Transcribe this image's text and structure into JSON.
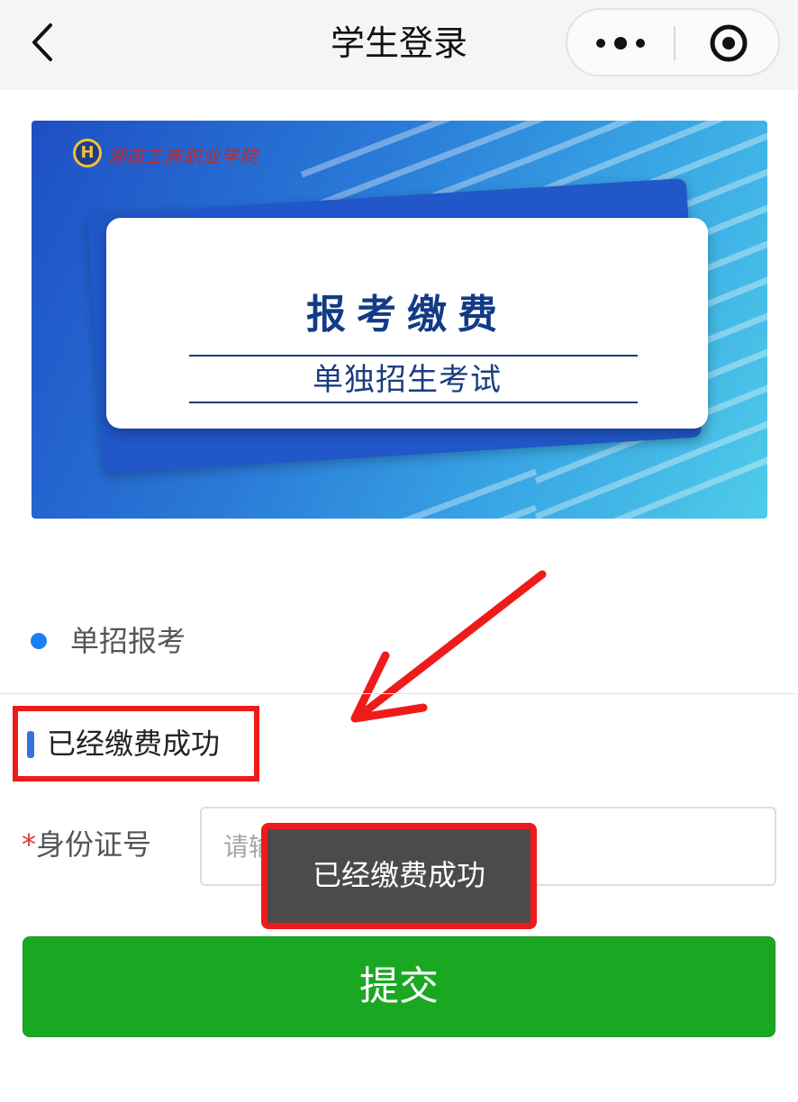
{
  "navbar": {
    "title": "学生登录",
    "back_icon": "chevron-left-icon",
    "menu_icon": "more-dots-icon",
    "close_icon": "target-circle-icon"
  },
  "banner": {
    "logo_initial": "H",
    "logo_text": "湖南工商职业学院",
    "title": "报考缴费",
    "subtitle": "单独招生考试",
    "colors": {
      "gradient_start": "#1e4fc4",
      "gradient_end": "#4fcbe9",
      "title_color": "#123b87"
    }
  },
  "section": {
    "radio_label": "单招报考",
    "status_text": "已经缴费成功"
  },
  "form": {
    "id_label": "身份证号",
    "id_required_mark": "*",
    "id_placeholder": "请输入身份证号",
    "submit_label": "提交"
  },
  "toast": {
    "message": "已经缴费成功"
  },
  "colors": {
    "accent_blue": "#1a7ff2",
    "submit_green": "#1aa822",
    "highlight_red": "#ee1b1b",
    "toast_bg": "#4b4b4b"
  }
}
